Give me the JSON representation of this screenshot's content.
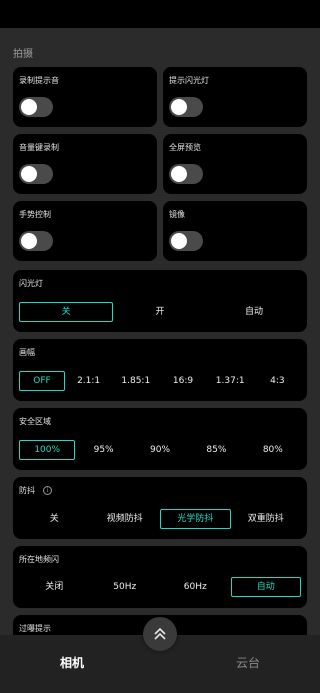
{
  "section": {
    "title": "拍摄"
  },
  "toggles": [
    {
      "label": "录制提示音",
      "on": false
    },
    {
      "label": "提示闪光灯",
      "on": false
    },
    {
      "label": "音量键录制",
      "on": false
    },
    {
      "label": "全屏预览",
      "on": false
    },
    {
      "label": "手势控制",
      "on": false
    },
    {
      "label": "镜像",
      "on": false
    }
  ],
  "flash": {
    "label": "闪光灯",
    "options": [
      "关",
      "开",
      "自动"
    ],
    "selected": "关"
  },
  "frame": {
    "label": "画幅",
    "options": [
      "OFF",
      "2.1:1",
      "1.85:1",
      "16:9",
      "1.37:1",
      "4:3"
    ],
    "selected": "OFF"
  },
  "safe_area": {
    "label": "安全区域",
    "options": [
      "100%",
      "95%",
      "90%",
      "85%",
      "80%"
    ],
    "selected": "100%"
  },
  "stabilization": {
    "label": "防抖",
    "info_icon": "info-icon",
    "options": [
      "关",
      "视频防抖",
      "光学防抖",
      "双重防抖"
    ],
    "selected": "光学防抖"
  },
  "flicker": {
    "label": "所在地频闪",
    "options": [
      "关闭",
      "50Hz",
      "60Hz",
      "自动"
    ],
    "selected": "自动"
  },
  "overexposure": {
    "label": "过曝提示"
  },
  "nav": {
    "camera": "相机",
    "gimbal": "云台",
    "expand_icon": "double-chevron-up-icon"
  },
  "colors": {
    "accent": "#26d8c4",
    "card": "#000000",
    "background": "#2b2b2b"
  }
}
